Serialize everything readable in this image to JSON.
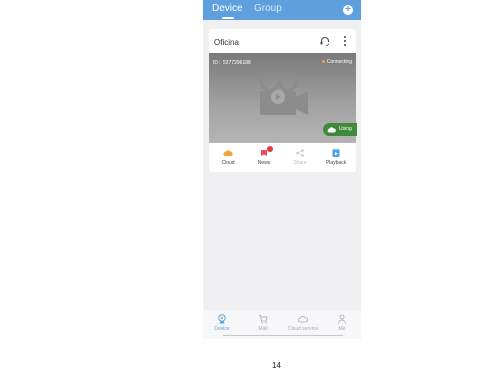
{
  "header": {
    "tabs": [
      {
        "label": "Device"
      },
      {
        "label": "Group"
      }
    ],
    "add_icon": "plus-circle-icon"
  },
  "device_card": {
    "name": "Oficina",
    "id_text": "ID：5277296188",
    "status": "Connecting",
    "status_color": "#f2a33a",
    "cloud_tag": "Using",
    "actions": [
      {
        "label": "Cloud",
        "icon": "cloud-icon",
        "color": "#f2a33a"
      },
      {
        "label": "News",
        "icon": "news-icon",
        "color": "#e94b5c"
      },
      {
        "label": "Share",
        "icon": "share-icon",
        "color": "#c9c9c9"
      },
      {
        "label": "Playback",
        "icon": "playback-icon",
        "color": "#4fa3e0"
      }
    ]
  },
  "bottom_nav": [
    {
      "label": "Device",
      "icon": "device-icon"
    },
    {
      "label": "Mall",
      "icon": "cart-icon"
    },
    {
      "label": "Cloud service",
      "icon": "cloud-service-icon"
    },
    {
      "label": "Me",
      "icon": "user-icon"
    }
  ],
  "page_number": "14",
  "colors": {
    "accent": "#5ea0dd",
    "using_green": "#3f8a3a"
  }
}
